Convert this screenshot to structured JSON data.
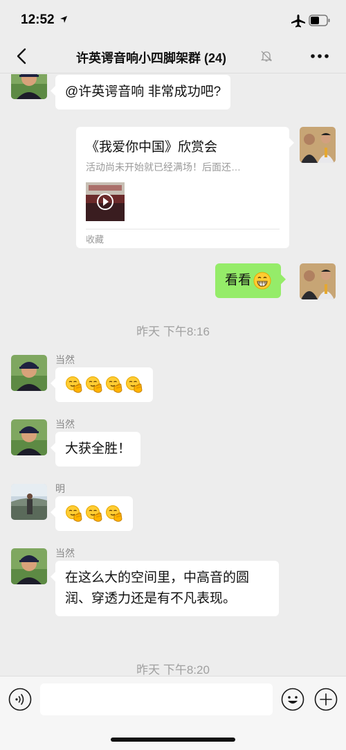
{
  "status_bar": {
    "time": "12:52",
    "icons": [
      "location-arrow-icon",
      "airplane-icon",
      "battery-icon"
    ]
  },
  "nav": {
    "title": "许英谔音响小四脚架群 (24)",
    "icons": [
      "back-icon",
      "mute-icon",
      "more-icon"
    ]
  },
  "messages": {
    "m1": {
      "text": "@许英谔音响 非常成功吧?"
    },
    "card": {
      "title": "《我爱你中国》欣赏会",
      "description": "活动尚未开始就已经满场！后面还…",
      "source": "收藏"
    },
    "m2": {
      "text": "看看",
      "emoji": "grin-emoji"
    },
    "time1": "昨天 下午8:16",
    "m3": {
      "sender": "当然",
      "emoji": "clap-emoji",
      "count": 4
    },
    "m4": {
      "sender": "当然",
      "text": "大获全胜！"
    },
    "m5": {
      "sender": "明",
      "emoji": "clap-emoji",
      "count": 3
    },
    "m6": {
      "sender": "当然",
      "text": "在这么大的空间里，中高音的圆润、穿透力还是有不凡表现。"
    },
    "time2": "昨天 下午8:20"
  },
  "input_bar": {
    "icons": [
      "voice-icon",
      "emoji-icon",
      "plus-icon"
    ]
  },
  "colors": {
    "background": "#ededed",
    "self_bubble": "#95ec69",
    "other_bubble": "#ffffff",
    "timestamp": "#a0a0a0"
  }
}
